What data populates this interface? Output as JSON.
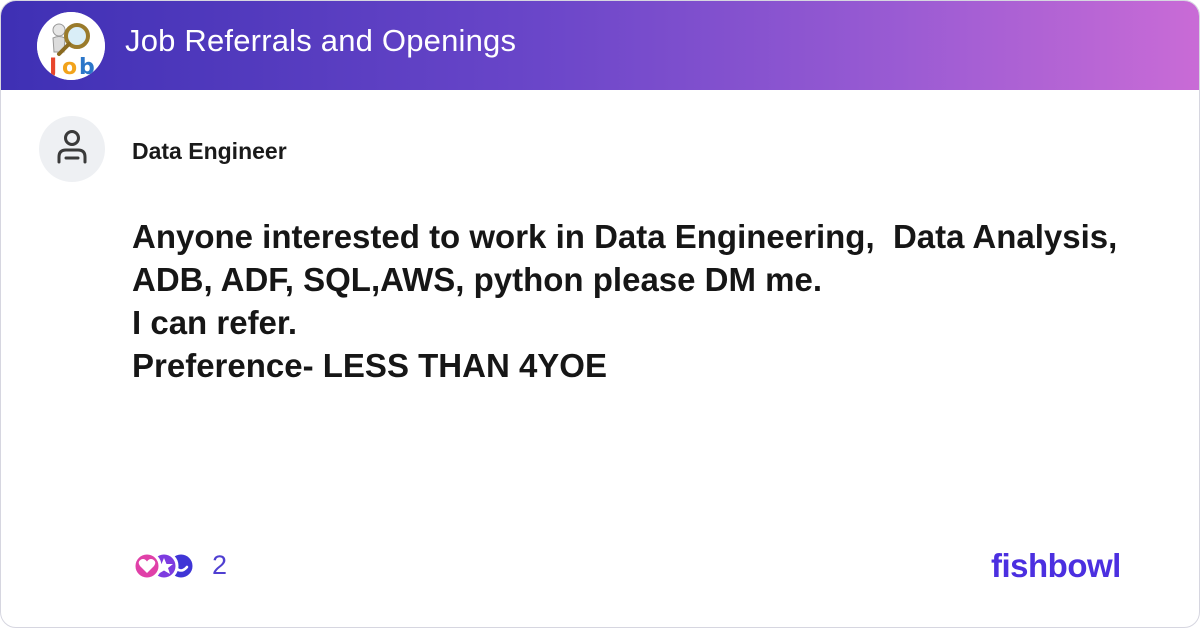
{
  "header": {
    "bowl_title": "Job Referrals and Openings",
    "logo_icon": "job-search-logo-icon",
    "gradient_colors": [
      "#3e30b4",
      "#6a46c9",
      "#9a5bd3",
      "#c96bd6"
    ]
  },
  "post": {
    "author": "Data Engineer",
    "avatar_icon": "person-icon",
    "lines": [
      "Anyone interested to work in Data Engineering,  Data Analysis,",
      "ADB, ADF, SQL,AWS, python please DM me.",
      "I can refer.",
      "Preference- LESS THAN 4YOE"
    ]
  },
  "footer": {
    "reaction_icons": [
      "heart-reaction-icon",
      "star-reaction-icon",
      "smile-reaction-icon"
    ],
    "reaction_count": "2",
    "brand": "fishbowl",
    "brand_color": "#4b2fe0"
  }
}
